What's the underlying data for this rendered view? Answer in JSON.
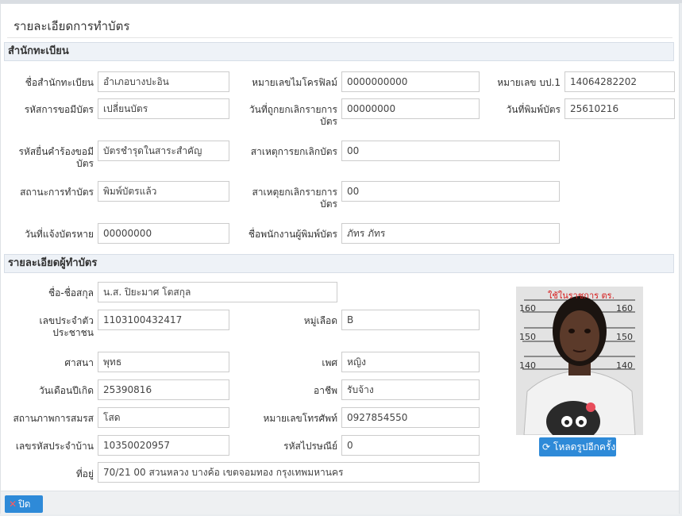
{
  "page_title": "รายละเอียดการทำบัตร",
  "sections": {
    "registry": "สำนักทะเบียน",
    "holder": "รายละเอียดผู้ทำบัตร"
  },
  "registry": {
    "office_name_label": "ชื่อสำนักทะเบียน",
    "office_name": "อำเภอบางปะอิน",
    "microfilm_label": "หมายเลขไมโครฟิลม์",
    "microfilm": "0000000000",
    "bp1_label": "หมายเลข บป.1",
    "bp1": "14064282202",
    "request_code_label": "รหัสการขอมีบัตร",
    "request_code": "เปลี่ยนบัตร",
    "cancel_list_date_label": "วันที่ถูกยกเลิกรายการบัตร",
    "cancel_list_date": "00000000",
    "print_date_label": "วันที่พิมพ์บัตร",
    "print_date": "25610216",
    "request_reason_label": "รหัสยื่นคำร้องขอมีบัตร",
    "request_reason": "บัตรชำรุดในสาระสำคัญ",
    "cancel_card_reason_label": "สาเหตุการยกเลิกบัตร",
    "cancel_card_reason": "00",
    "status_label": "สถานะการทำบัตร",
    "status": "พิมพ์บัตรแล้ว",
    "cancel_list_reason_label": "สาเหตุยกเลิกรายการบัตร",
    "cancel_list_reason": "00",
    "lost_date_label": "วันที่แจ้งบัตรหาย",
    "lost_date": "00000000",
    "printer_name_label": "ชื่อพนักงานผู้พิมพ์บัตร",
    "printer_name": "ภัทร ภัทร"
  },
  "holder": {
    "name_label": "ชื่อ-ชื่อสกุล",
    "name": "น.ส. ปิยะมาศ โตสกุล",
    "id_label": "เลขประจำตัวประชาชน",
    "id": "1103100432417",
    "blood_label": "หมู่เลือด",
    "blood": "B",
    "religion_label": "ศาสนา",
    "religion": "พุทธ",
    "sex_label": "เพศ",
    "sex": "หญิง",
    "birth_label": "วันเดือนปีเกิด",
    "birth": "25390816",
    "job_label": "อาชีพ",
    "job": "รับจ้าง",
    "marital_label": "สถานภาพการสมรส",
    "marital": "โสด",
    "phone_label": "หมายเลขโทรศัพท์",
    "phone": "0927854550",
    "house_code_label": "เลขรหัสประจำบ้าน",
    "house_code": "10350020957",
    "postal_label": "รหัสไปรษณีย์",
    "postal": "0",
    "address_label": "ที่อยู่",
    "address": "70/21 00 สวนหลวง บางค้อ เขตจอมทอง กรุงเทพมหานคร"
  },
  "photo": {
    "caption": "ใช้ในราชการ ตร.",
    "ruler_marks": [
      "160",
      "150",
      "140"
    ]
  },
  "buttons": {
    "reload": "โหลดรูปอีกครั้ง",
    "close": "ปิด"
  },
  "colors": {
    "accent": "#2e8ad8",
    "section_bg": "#eef2f7"
  }
}
